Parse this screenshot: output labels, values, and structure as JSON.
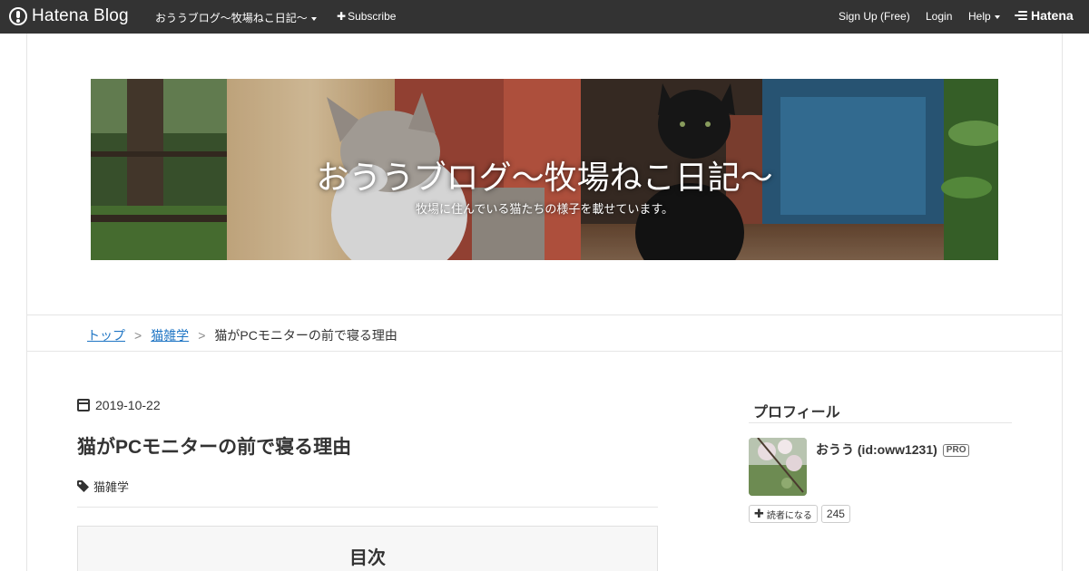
{
  "global_header": {
    "logo_text": "Hatena Blog",
    "blog_name": "おううブログ～牧場ねこ日記～",
    "subscribe_label": "Subscribe",
    "signup_label": "Sign Up (Free)",
    "login_label": "Login",
    "help_label": "Help",
    "hatena_label": "Hatena"
  },
  "blog": {
    "title": "おううブログ～牧場ねこ日記～",
    "description": "牧場に住んでいる猫たちの様子を載せています。"
  },
  "breadcrumb": {
    "items": [
      "トップ",
      "猫雑学",
      "猫がPCモニターの前で寝る理由"
    ],
    "separator": ">"
  },
  "entry": {
    "date": "2019-10-22",
    "title": "猫がPCモニターの前で寝る理由",
    "category": "猫雑学",
    "toc_title": "目次"
  },
  "sidebar": {
    "profile_heading": "プロフィール",
    "user_name": "おうう (id:oww1231)",
    "badge": "PRO",
    "subscribe_label": "読者になる",
    "subscriber_count": "245"
  },
  "colors": {
    "header_bg": "#333333",
    "link": "#1f75c4"
  }
}
